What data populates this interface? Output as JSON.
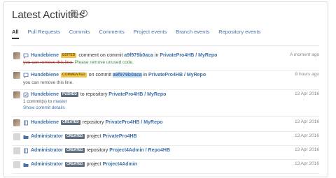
{
  "header": {
    "title": "Latest Activities",
    "rss_icon": "rss-icon",
    "info_icon": "info-icon"
  },
  "tabs": [
    {
      "label": "All",
      "active": true
    },
    {
      "label": "Pull Requests"
    },
    {
      "label": "Commits"
    },
    {
      "label": "Comments"
    },
    {
      "label": "Project events"
    },
    {
      "label": "Branch events"
    },
    {
      "label": "Repository events"
    }
  ],
  "activities": [
    {
      "user": "Hundebiene",
      "badge": "EDITED",
      "text1": "comment on commit",
      "commit": "a9f979b0aca",
      "in": "in",
      "repo": "PrivatePro4HB / MyRepo",
      "time": "A moment ago",
      "sub_strike": "you can remove this line.",
      "sub_add": "Please remove unused code."
    },
    {
      "user": "Hundebiene",
      "badge": "COMMENTED",
      "text1": "on commit",
      "commit": "a9f979b0aca",
      "in": "in",
      "repo": "PrivatePro4HB / MyRepo",
      "time": "8 hours ago",
      "sub": "you can remove this line."
    },
    {
      "user": "Hundebiene",
      "badge": "PUSHED",
      "text1": "to repository",
      "repo": "PrivatePro4HB / MyRepo",
      "time": "13 Apr 2016",
      "sub_count": "1 commit(s) to",
      "sub_branch": "master",
      "sub_link": "Show commit details"
    },
    {
      "user": "Hundebiene",
      "badge": "CREATED",
      "text1": "repository",
      "repo": "PrivatePro4HB / MyRepo",
      "time": "13 Apr 2016"
    },
    {
      "user": "Administrator",
      "badge": "CREATED",
      "text1": "project",
      "repo": "PrivatePro4HB",
      "time": "13 Apr 2016"
    },
    {
      "user": "Administrator",
      "badge": "CREATED",
      "text1": "repository",
      "repo": "Project4Admin / Repo4HB",
      "time": "13 Apr 2016"
    },
    {
      "user": "Administrator",
      "badge": "CREATED",
      "text1": "project",
      "repo": "Project4Admin",
      "time": "13 Apr 2016"
    }
  ]
}
